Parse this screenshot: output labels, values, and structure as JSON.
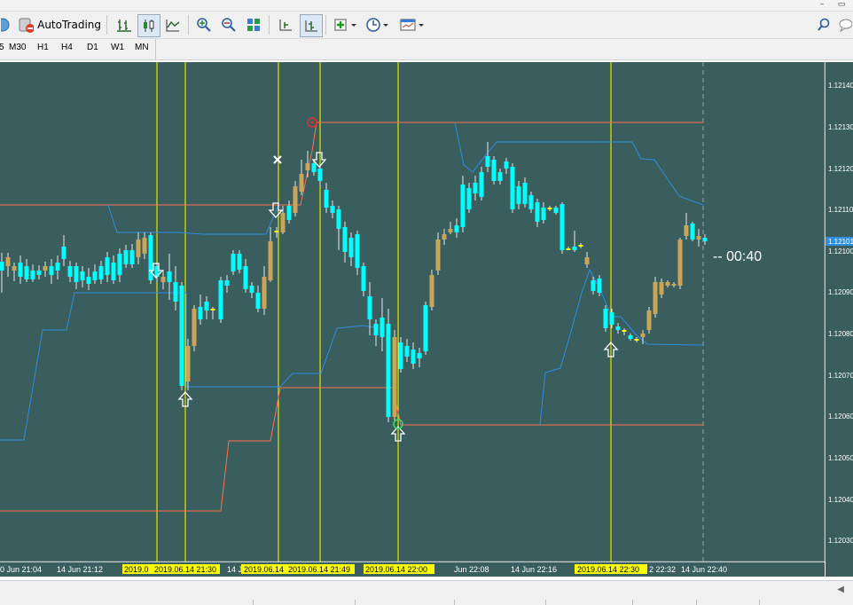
{
  "window": {
    "restore_glyph": "▭",
    "min_glyph": "–"
  },
  "toolbar": {
    "autotrading_label": "AutoTrading",
    "icons": [
      "bar-chart-icon",
      "candlestick-icon",
      "line-chart-icon",
      "zoom-in-icon",
      "zoom-out-icon",
      "tile-windows-icon",
      "chart-shift-icon",
      "autoscroll-icon",
      "indicators-icon",
      "periods-icon",
      "templates-icon",
      "search-icon",
      "chat-icon"
    ]
  },
  "timeframes": [
    "M30",
    "H1",
    "H4",
    "D1",
    "W1",
    "MN"
  ],
  "timeframe_left_fragment": "5",
  "chart": {
    "background": "#3a5d5d",
    "bull_color": "#c9a55a",
    "bear_color": "#00ffff",
    "doji_color": "#ffff00",
    "upper_channel_color": "#ff6e4e",
    "lower_channel_color": "#2e8fe0",
    "vline_color": "#ffff00",
    "countdown": "-- 00:40",
    "price_labels": [
      "1.12140",
      "1.12130",
      "1.12120",
      "1.12110",
      "1.12100",
      "1.12090",
      "1.12080",
      "1.12070",
      "1.12060",
      "1.12050",
      "1.12040",
      "1.12030"
    ],
    "current_price": "1.12101",
    "time_labels": [
      "0 Jun 21:04",
      "14 Jun 21:12",
      "14 J",
      "Jun 22:08",
      "14 Jun 22:16",
      "2 22:32",
      "14 Jun 22:40"
    ],
    "highlight_labels": [
      "2019.0",
      "2019.06.14 21:30",
      "2019.06.14",
      "2019.06.14 21:49",
      "2019.06.14 22:00",
      "2019.06.14 22:30"
    ]
  }
}
